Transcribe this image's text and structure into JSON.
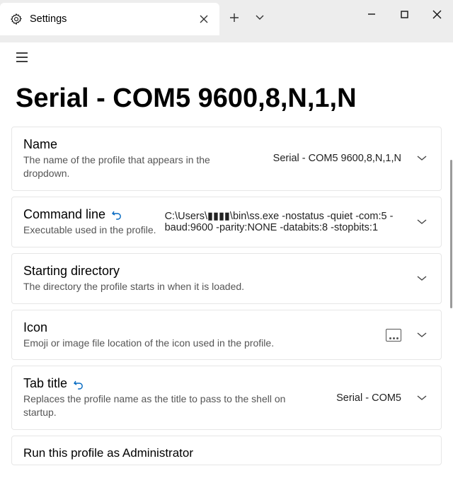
{
  "tab": {
    "title": "Settings"
  },
  "page": {
    "title": "Serial - COM5 9600,8,N,1,N"
  },
  "settings": {
    "name": {
      "label": "Name",
      "desc": "The name of the profile that appears in the dropdown.",
      "value": "Serial - COM5 9600,8,N,1,N"
    },
    "commandline": {
      "label": "Command line",
      "desc": "Executable used in the profile.",
      "value": "C:\\Users\\▮▮▮▮\\bin\\ss.exe -nostatus -quiet -com:5 -baud:9600 -parity:NONE -databits:8 -stopbits:1"
    },
    "startdir": {
      "label": "Starting directory",
      "desc": "The directory the profile starts in when it is loaded."
    },
    "icon": {
      "label": "Icon",
      "desc": "Emoji or image file location of the icon used in the profile."
    },
    "tabtitle": {
      "label": "Tab title",
      "desc": "Replaces the profile name as the title to pass to the shell on startup.",
      "value": "Serial - COM5"
    },
    "admin": {
      "label": "Run this profile as Administrator"
    }
  }
}
